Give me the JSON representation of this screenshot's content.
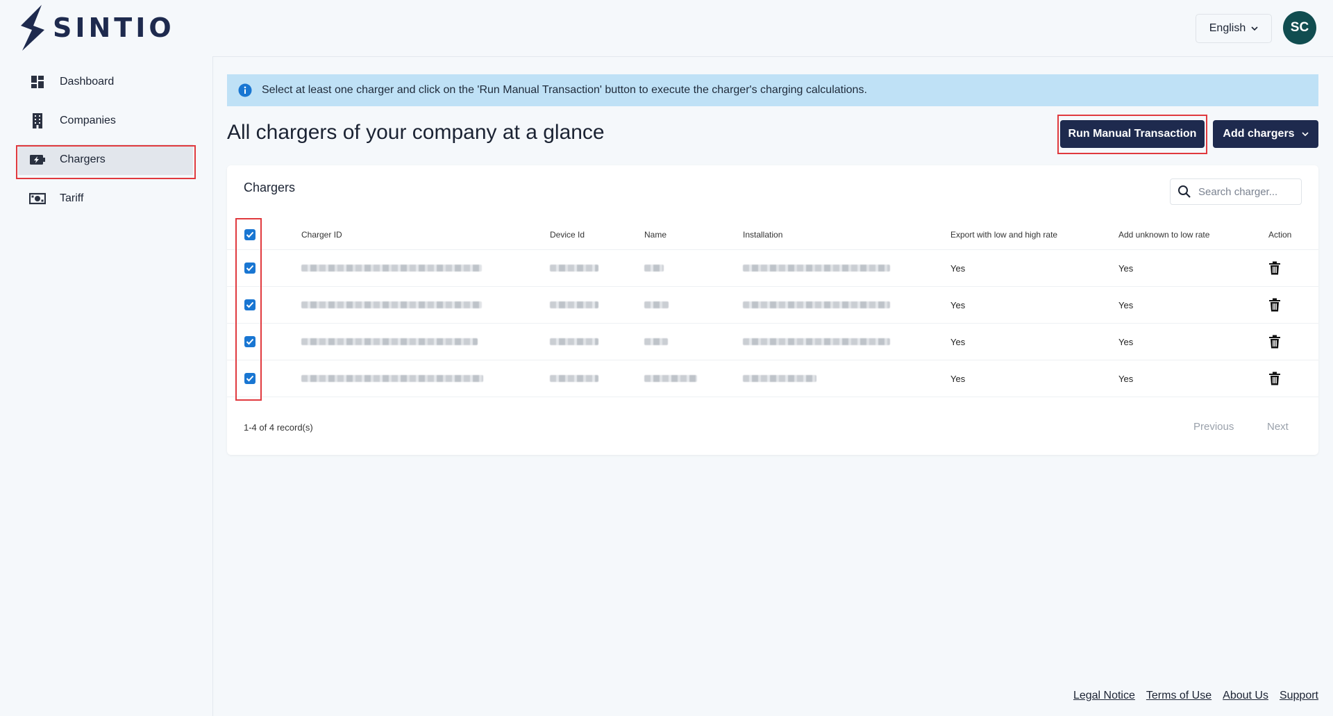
{
  "brand": {
    "name": "SINTIO",
    "color": "#1e2a4e"
  },
  "header": {
    "language": "English",
    "avatar_initials": "SC"
  },
  "sidebar": {
    "items": [
      {
        "label": "Dashboard",
        "icon": "dashboard-icon"
      },
      {
        "label": "Companies",
        "icon": "building-icon"
      },
      {
        "label": "Chargers",
        "icon": "charger-icon",
        "active": true
      },
      {
        "label": "Tariff",
        "icon": "money-icon"
      }
    ]
  },
  "info_banner": {
    "text": "Select at least one charger and click on the 'Run Manual Transaction' button to execute the charger's charging calculations."
  },
  "page": {
    "title": "All chargers of your company at a glance",
    "run_button": "Run Manual Transaction",
    "add_button": "Add chargers"
  },
  "card": {
    "title": "Chargers",
    "search_placeholder": "Search charger...",
    "columns": [
      "Charger ID",
      "Device Id",
      "Name",
      "Installation",
      "Export with low and high rate",
      "Add unknown to low rate",
      "Action"
    ],
    "rows": [
      {
        "export": "Yes",
        "unknown": "Yes",
        "checked": true
      },
      {
        "export": "Yes",
        "unknown": "Yes",
        "checked": true
      },
      {
        "export": "Yes",
        "unknown": "Yes",
        "checked": true
      },
      {
        "export": "Yes",
        "unknown": "Yes",
        "checked": true
      }
    ],
    "records": "1-4 of 4 record(s)",
    "previous": "Previous",
    "next": "Next"
  },
  "footer": {
    "legal": "Legal Notice",
    "terms": "Terms of Use",
    "about": "About Us",
    "support": "Support"
  },
  "colors": {
    "accent": "#1e2a4e",
    "info_bg": "#bfe1f6",
    "highlight": "#e0393e",
    "checkbox": "#1976d2",
    "avatar": "#114d50"
  }
}
